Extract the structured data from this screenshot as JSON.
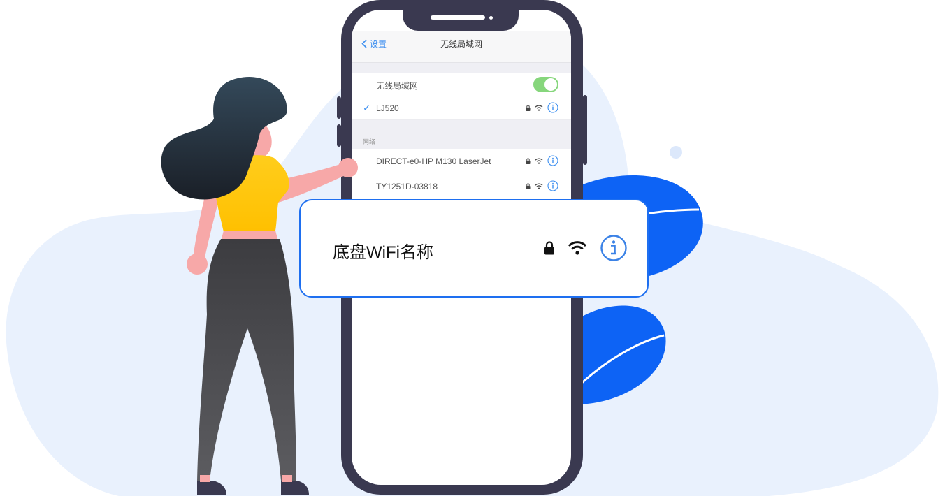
{
  "nav": {
    "back_label": "设置",
    "title": "无线局域网"
  },
  "wifi_toggle": {
    "label": "无线局域网",
    "state": "on"
  },
  "connected": {
    "name": "LJ520"
  },
  "section_label": "网络",
  "networks": [
    {
      "name": "DIRECT-e0-HP M130 LaserJet"
    },
    {
      "name": "TY1251D-03818"
    }
  ],
  "callout": {
    "label": "底盘WiFi名称"
  },
  "colors": {
    "accent": "#1e6ff0",
    "phone": "#3a3950",
    "blob": "#e9f1fd",
    "leaf": "#0d63f5",
    "toggle": "#86d67c"
  },
  "icons": [
    "chevron-left-icon",
    "check-icon",
    "lock-icon",
    "wifi-icon",
    "info-icon"
  ]
}
